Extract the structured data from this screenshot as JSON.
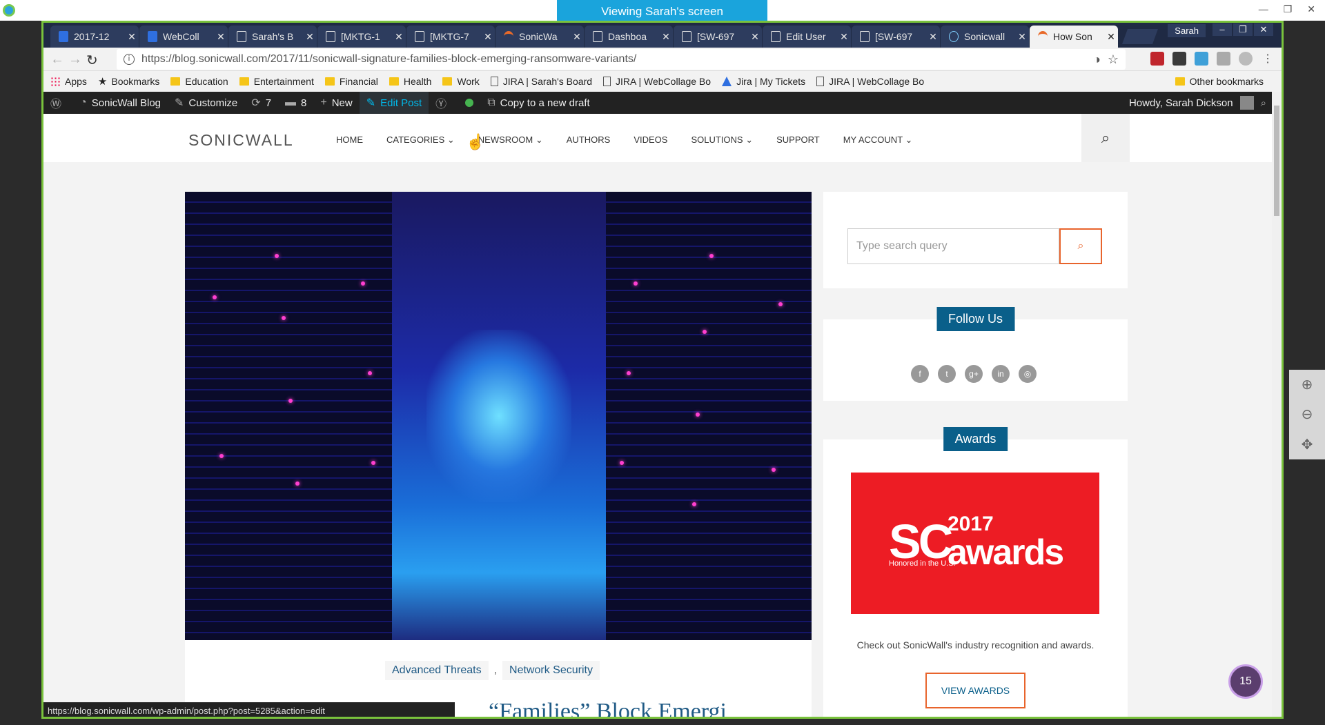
{
  "banner": "Viewing Sarah's screen",
  "browser": {
    "profile": "Sarah",
    "tabs": [
      {
        "title": "2017-12",
        "icon": "jira-icon"
      },
      {
        "title": "WebColl",
        "icon": "jira-icon"
      },
      {
        "title": "Sarah's B",
        "icon": "page-icon"
      },
      {
        "title": "[MKTG-1",
        "icon": "page-icon"
      },
      {
        "title": "[MKTG-7",
        "icon": "page-icon"
      },
      {
        "title": "SonicWa",
        "icon": "sonicwall-icon"
      },
      {
        "title": "Dashboa",
        "icon": "page-icon"
      },
      {
        "title": "[SW-697",
        "icon": "page-icon"
      },
      {
        "title": "Edit User",
        "icon": "page-icon"
      },
      {
        "title": "[SW-697",
        "icon": "page-icon"
      },
      {
        "title": "Sonicwall",
        "icon": "globe-icon"
      },
      {
        "title": "How Son",
        "icon": "sonicwall-icon",
        "active": true
      }
    ],
    "url": "https://blog.sonicwall.com/2017/11/sonicwall-signature-families-block-emerging-ransomware-variants/",
    "bookmarks": [
      {
        "label": "Apps",
        "type": "apps"
      },
      {
        "label": "Bookmarks",
        "type": "star"
      },
      {
        "label": "Education",
        "type": "folder"
      },
      {
        "label": "Entertainment",
        "type": "folder"
      },
      {
        "label": "Financial",
        "type": "folder"
      },
      {
        "label": "Health",
        "type": "folder"
      },
      {
        "label": "Work",
        "type": "folder"
      },
      {
        "label": "JIRA | Sarah's Board",
        "type": "page"
      },
      {
        "label": "JIRA | WebCollage Bo",
        "type": "page"
      },
      {
        "label": "Jira | My Tickets",
        "type": "jira"
      },
      {
        "label": "JIRA | WebCollage Bo",
        "type": "page"
      }
    ],
    "other_bookmarks": "Other bookmarks",
    "status_url": "https://blog.sonicwall.com/wp-admin/post.php?post=5285&action=edit"
  },
  "wp_bar": {
    "site": "SonicWall Blog",
    "customize": "Customize",
    "updates": "7",
    "comments": "8",
    "new": "New",
    "edit_post": "Edit Post",
    "copy_draft": "Copy to a new draft",
    "howdy": "Howdy, Sarah Dickson"
  },
  "site": {
    "logo": "SONICWALL",
    "menu": [
      {
        "label": "HOME",
        "dropdown": false
      },
      {
        "label": "CATEGORIES",
        "dropdown": true
      },
      {
        "label": "NEWSROOM",
        "dropdown": true
      },
      {
        "label": "AUTHORS",
        "dropdown": false
      },
      {
        "label": "VIDEOS",
        "dropdown": false
      },
      {
        "label": "SOLUTIONS",
        "dropdown": true
      },
      {
        "label": "SUPPORT",
        "dropdown": false
      },
      {
        "label": "MY ACCOUNT",
        "dropdown": true
      }
    ]
  },
  "post": {
    "categories": [
      "Advanced Threats",
      "Network Security"
    ],
    "separator": ",",
    "title_partial": "“Families” Block Emergi"
  },
  "sidebar": {
    "search_placeholder": "Type search query",
    "follow_title": "Follow Us",
    "social": [
      "f",
      "t",
      "g+",
      "in",
      "rss"
    ],
    "awards_title": "Awards",
    "award_image": {
      "sc": "SC",
      "year": "2017",
      "awards": "awards",
      "honored": "Honored in the U.S."
    },
    "awards_text": "Check out SonicWall's industry recognition and awards.",
    "view_awards": "VIEW AWARDS"
  },
  "notification_count": "15",
  "colors": {
    "accent": "#e8642c",
    "brand_blue": "#0a5f8a",
    "frame_green": "#79c23c",
    "banner": "#1aa4dc"
  }
}
